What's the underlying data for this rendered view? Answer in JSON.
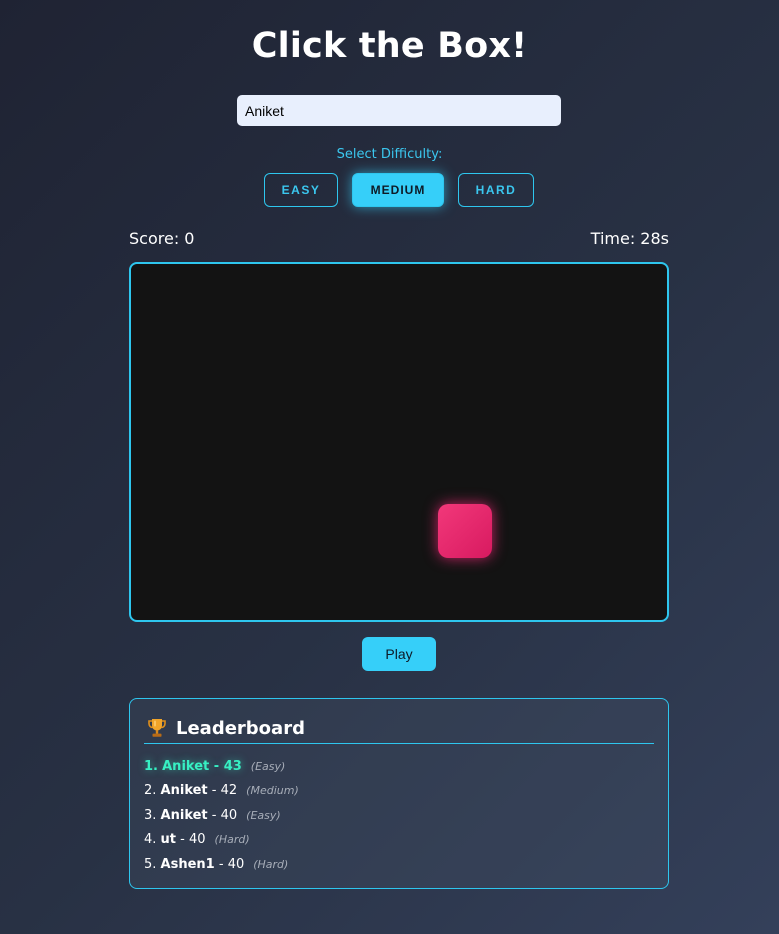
{
  "title": "Click the Box!",
  "player_name": "Aniket",
  "difficulty": {
    "label": "Select Difficulty:",
    "options": [
      "EASY",
      "MEDIUM",
      "HARD"
    ],
    "selected": "MEDIUM"
  },
  "stats": {
    "score_text": "Score: 0",
    "time_text": "Time: 28s"
  },
  "play_label": "Play",
  "leaderboard": {
    "title": "Leaderboard",
    "entries": [
      {
        "rank": "1.",
        "name": "Aniket",
        "points": "43",
        "mode": "(Easy)"
      },
      {
        "rank": "2.",
        "name": "Aniket",
        "points": "42",
        "mode": "(Medium)"
      },
      {
        "rank": "3.",
        "name": "Aniket",
        "points": "40",
        "mode": "(Easy)"
      },
      {
        "rank": "4.",
        "name": "ut",
        "points": "40",
        "mode": "(Hard)"
      },
      {
        "rank": "5.",
        "name": "Ashen1",
        "points": "40",
        "mode": "(Hard)"
      }
    ]
  },
  "colors": {
    "accent": "#36cff9",
    "target": "#e8286f",
    "top_entry": "#37f0c3",
    "game_bg": "#131313"
  },
  "icons": {
    "trophy": "trophy-icon"
  }
}
